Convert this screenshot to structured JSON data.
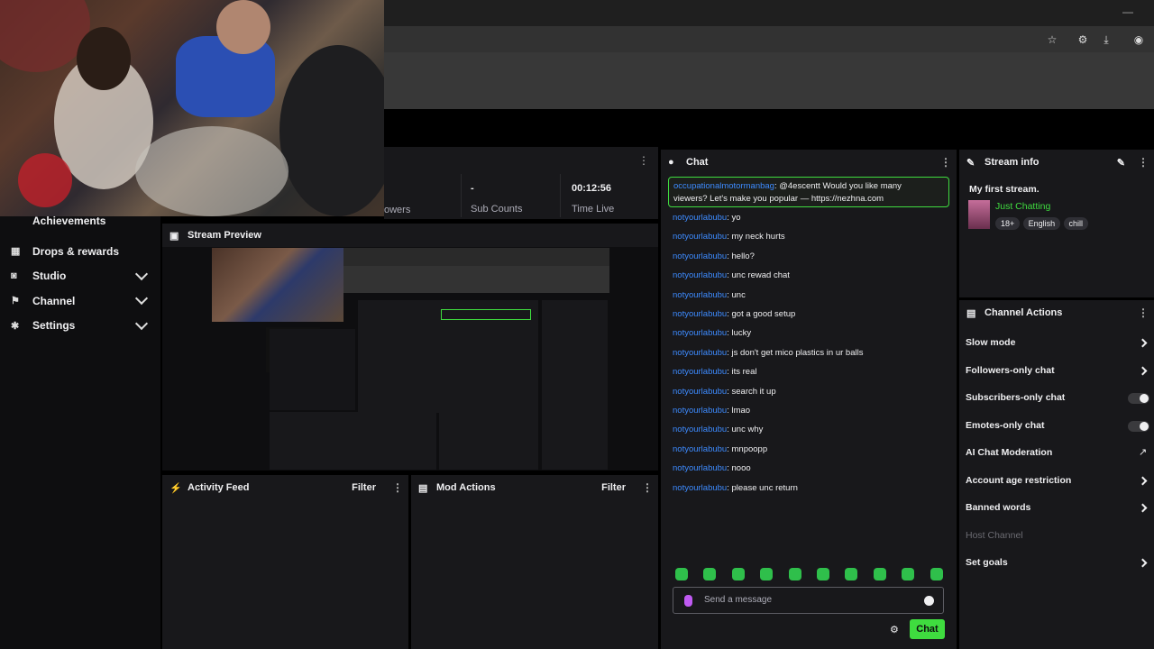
{
  "stats": {
    "followers_label": "owers",
    "sub_counts_value": "-",
    "sub_counts_label": "Sub Counts",
    "time_live_value": "00:12:56",
    "time_live_label": "Time Live"
  },
  "sidebar": {
    "items": [
      {
        "label": "Achievements",
        "icon": "trophy-icon"
      },
      {
        "label": "Drops & rewards",
        "icon": "gift-icon"
      },
      {
        "label": "Studio",
        "icon": "camera-icon"
      },
      {
        "label": "Channel",
        "icon": "channel-icon"
      },
      {
        "label": "Settings",
        "icon": "gear-icon"
      }
    ]
  },
  "stream_preview": {
    "title": "Stream Preview"
  },
  "activity_feed": {
    "title": "Activity Feed",
    "filter_label": "Filter"
  },
  "mod_actions": {
    "title": "Mod Actions",
    "filter_label": "Filter"
  },
  "chat": {
    "title": "Chat",
    "highlight": {
      "user": "occupationalmotormanbag",
      "text": ": @4escentt Would you like many",
      "text2": "viewers? Let's make you popular — https://nezhna.com"
    },
    "messages": [
      {
        "user": "notyourlabubu",
        "text": ": yo"
      },
      {
        "user": "notyourlabubu",
        "text": ": my neck hurts"
      },
      {
        "user": "notyourlabubu",
        "text": ": hello?"
      },
      {
        "user": "notyourlabubu",
        "text": ": unc rewad chat"
      },
      {
        "user": "notyourlabubu",
        "text": ": unc"
      },
      {
        "user": "notyourlabubu",
        "text": ": got a good setup"
      },
      {
        "user": "notyourlabubu",
        "text": ": lucky"
      },
      {
        "user": "notyourlabubu",
        "text": ": js don't get mico plastics in ur balls"
      },
      {
        "user": "notyourlabubu",
        "text": ": its real"
      },
      {
        "user": "notyourlabubu",
        "text": ": search it up"
      },
      {
        "user": "notyourlabubu",
        "text": ": lmao"
      },
      {
        "user": "notyourlabubu",
        "text": ": unc why"
      },
      {
        "user": "notyourlabubu",
        "text": ": mnpoopp"
      },
      {
        "user": "notyourlabubu",
        "text": ": nooo"
      },
      {
        "user": "notyourlabubu",
        "text": ": please unc return"
      }
    ],
    "input_placeholder": "Send a message",
    "send_label": "Chat"
  },
  "stream_info": {
    "title": "Stream info",
    "stream_title": "My first stream.",
    "category": "Just Chatting",
    "tags": [
      "18+",
      "English",
      "chill"
    ]
  },
  "channel_actions": {
    "title": "Channel Actions",
    "items": [
      {
        "label": "Slow mode",
        "control": "arrow"
      },
      {
        "label": "Followers-only chat",
        "control": "arrow"
      },
      {
        "label": "Subscribers-only chat",
        "control": "toggle-off"
      },
      {
        "label": "Emotes-only chat",
        "control": "toggle-off"
      },
      {
        "label": "AI Chat Moderation",
        "control": "external"
      },
      {
        "label": "Account age restriction",
        "control": "arrow"
      },
      {
        "label": "Banned words",
        "control": "arrow"
      },
      {
        "label": "Host Channel",
        "control": "disabled"
      },
      {
        "label": "Set goals",
        "control": "arrow"
      }
    ]
  },
  "colors": {
    "accent_green": "#3fdc3f",
    "username_blue": "#3d8bff",
    "panel_bg": "#18181b",
    "page_bg": "#0e0e10"
  }
}
